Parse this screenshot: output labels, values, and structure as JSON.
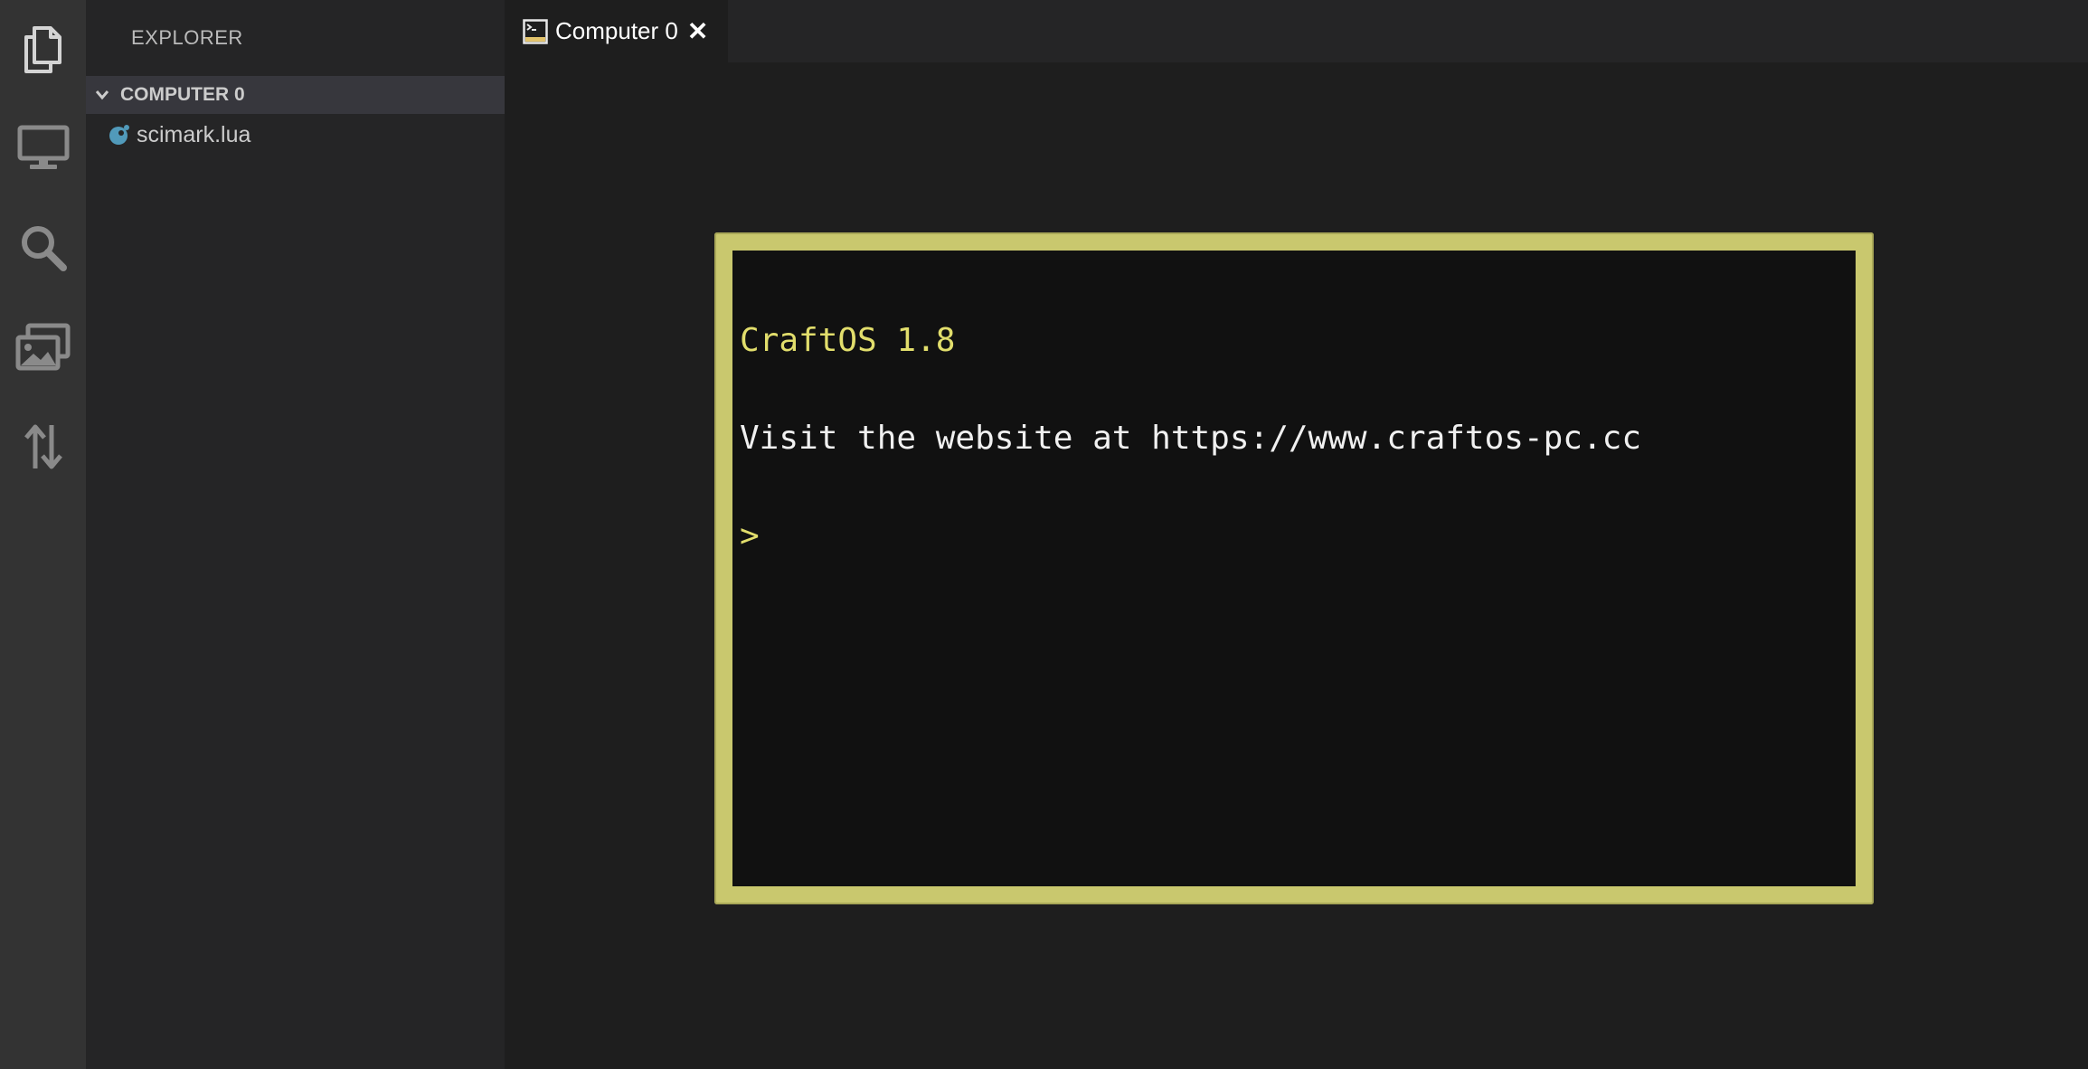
{
  "activity_bar": {
    "items": [
      {
        "icon": "files-icon"
      },
      {
        "icon": "monitor-icon"
      },
      {
        "icon": "search-icon"
      },
      {
        "icon": "images-icon"
      },
      {
        "icon": "transfer-icon"
      }
    ]
  },
  "sidebar": {
    "title": "EXPLORER",
    "section": {
      "label": "COMPUTER 0",
      "files": [
        {
          "name": "scimark.lua",
          "icon": "lua-file-icon"
        }
      ]
    }
  },
  "editor": {
    "tabs": [
      {
        "label": "Computer 0",
        "close": "✕",
        "icon": "terminal-icon"
      }
    ],
    "terminal": {
      "lines": [
        "CraftOS 1.8",
        "Visit the website at https://www.craftos-pc.cc"
      ],
      "prompt": ">"
    }
  },
  "colors": {
    "terminal_border": "#c9c86e",
    "terminal_bg": "#111111",
    "terminal_yellow": "#e2de6c",
    "accent_lua": "#519aba"
  }
}
